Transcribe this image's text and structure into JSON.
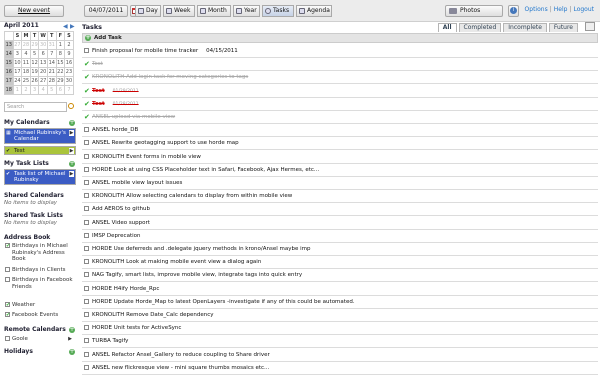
{
  "toolbar": {
    "new_event": "New event",
    "date": "04/07/2011",
    "views": [
      {
        "label": "Day",
        "icon": "day-icon"
      },
      {
        "label": "Week",
        "icon": "week-icon"
      },
      {
        "label": "Month",
        "icon": "month-icon"
      },
      {
        "label": "Year",
        "icon": "year-icon"
      },
      {
        "label": "Tasks",
        "icon": "tasks-icon"
      },
      {
        "label": "Agenda",
        "icon": "agenda-icon"
      }
    ],
    "photos": "Photos",
    "links": [
      "Options",
      "Help",
      "Logout"
    ]
  },
  "minical": {
    "month": "April 2011",
    "headers": [
      "",
      "S",
      "M",
      "T",
      "W",
      "T",
      "F",
      "S"
    ],
    "weeks": [
      {
        "wk": "13",
        "days": [
          "27",
          "28",
          "29",
          "30",
          "31",
          "1",
          "2"
        ]
      },
      {
        "wk": "14",
        "days": [
          "3",
          "4",
          "5",
          "6",
          "7",
          "8",
          "9"
        ]
      },
      {
        "wk": "15",
        "days": [
          "10",
          "11",
          "12",
          "13",
          "14",
          "15",
          "16"
        ]
      },
      {
        "wk": "16",
        "days": [
          "17",
          "18",
          "19",
          "20",
          "21",
          "22",
          "23"
        ]
      },
      {
        "wk": "17",
        "days": [
          "24",
          "25",
          "26",
          "27",
          "28",
          "29",
          "30"
        ]
      },
      {
        "wk": "18",
        "days": [
          "1",
          "2",
          "3",
          "4",
          "5",
          "6",
          "7"
        ]
      }
    ]
  },
  "sidebar": {
    "search_placeholder": "Search",
    "my_calendars": "My Calendars",
    "calendars": [
      {
        "label": "Michael Rubinsky's Calendar",
        "color": "#3b5cc4"
      },
      {
        "label": "Test",
        "color": "#aac43b"
      }
    ],
    "my_tasklists": "My Task Lists",
    "tasklists": [
      {
        "label": "Task list of Michael Rubinsky",
        "color": "#3b5cc4"
      }
    ],
    "shared_calendars": "Shared Calendars",
    "shared_calendars_none": "No items to display",
    "shared_tasklists": "Shared Task Lists",
    "shared_tasklists_none": "No items to display",
    "address_book": "Address Book",
    "address_items": [
      "Birthdays in Michael Rubinsky's Address Book",
      "Birthdays in Clients",
      "Birthdays in Facebook Friends"
    ],
    "other_items": [
      "Weather",
      "Facebook Events"
    ],
    "remote_calendars": "Remote Calendars",
    "remote_items": [
      "Goole"
    ],
    "holidays": "Holidays"
  },
  "main": {
    "title": "Tasks",
    "tabs": [
      "All",
      "Completed",
      "Incomplete",
      "Future"
    ],
    "add_task": "Add Task",
    "tasks": [
      {
        "text": "Finish proposal for mobile time tracker",
        "due": "04/15/2011",
        "state": "open"
      },
      {
        "text": "Test",
        "due": "",
        "state": "done"
      },
      {
        "text": "KRONOLITH Add login task for moving categories to tags",
        "due": "",
        "state": "done"
      },
      {
        "text": "Test",
        "due": "01/29/2011",
        "state": "overdue"
      },
      {
        "text": "Test",
        "due": "01/28/2011",
        "state": "overdue"
      },
      {
        "text": "ANSEL upload via mobile view",
        "due": "",
        "state": "done"
      },
      {
        "text": "ANSEL horde_DB",
        "due": "",
        "state": "open"
      },
      {
        "text": "ANSEL Rewrite geotagging support to use horde map",
        "due": "",
        "state": "open"
      },
      {
        "text": "KRONOLITH Event forms in mobile view",
        "due": "",
        "state": "open"
      },
      {
        "text": "HORDE Look at using CSS Placeholder text in Safari, Facebook, Ajax Hermes, etc...",
        "due": "",
        "state": "open"
      },
      {
        "text": "ANSEL mobile view layout issues",
        "due": "",
        "state": "open"
      },
      {
        "text": "KRONOLITH Allow selecting calendars to display from within mobile view",
        "due": "",
        "state": "open"
      },
      {
        "text": "Add AEROS to github",
        "due": "",
        "state": "open"
      },
      {
        "text": "ANSEL Video support",
        "due": "",
        "state": "open"
      },
      {
        "text": "IMSP Deprecation",
        "due": "",
        "state": "open"
      },
      {
        "text": "HORDE Use deferreds and .delegate jquery methods in krono/Ansel maybe imp",
        "due": "",
        "state": "open"
      },
      {
        "text": "KRONOLITH Look at making mobile event view a dialog again",
        "due": "",
        "state": "open"
      },
      {
        "text": "NAG Tagify, smart lists, improve mobile view, integrate tags into quick entry",
        "due": "",
        "state": "open"
      },
      {
        "text": "HORDE H4ify Horde_Rpc",
        "due": "",
        "state": "open"
      },
      {
        "text": "HORDE Update Horde_Map to latest OpenLayers -investigate if any of this could be automated.",
        "due": "",
        "state": "open"
      },
      {
        "text": "KRONOLITH Remove Date_Calc dependency",
        "due": "",
        "state": "open"
      },
      {
        "text": "HORDE Unit tests for ActiveSync",
        "due": "",
        "state": "open"
      },
      {
        "text": "TURBA Tagify",
        "due": "",
        "state": "open"
      },
      {
        "text": "ANSEL Refactor Ansel_Gallery to reduce coupling to Share driver",
        "due": "",
        "state": "open"
      },
      {
        "text": "ANSEL new flickresque view - mini square thumbs mosaics etc...",
        "due": "",
        "state": "open"
      }
    ]
  }
}
